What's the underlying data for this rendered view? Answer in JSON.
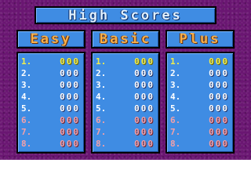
{
  "title": "High Scores",
  "tabs": {
    "easy": "Easy",
    "basic": "Basic",
    "plus": "Plus"
  },
  "lists": {
    "easy": [
      {
        "rank": "1.",
        "score": "000"
      },
      {
        "rank": "2.",
        "score": "000"
      },
      {
        "rank": "3.",
        "score": "000"
      },
      {
        "rank": "4.",
        "score": "000"
      },
      {
        "rank": "5.",
        "score": "000"
      },
      {
        "rank": "6.",
        "score": "000"
      },
      {
        "rank": "7.",
        "score": "000"
      },
      {
        "rank": "8.",
        "score": "000"
      }
    ],
    "basic": [
      {
        "rank": "1.",
        "score": "000"
      },
      {
        "rank": "2.",
        "score": "000"
      },
      {
        "rank": "3.",
        "score": "000"
      },
      {
        "rank": "4.",
        "score": "000"
      },
      {
        "rank": "5.",
        "score": "000"
      },
      {
        "rank": "6.",
        "score": "000"
      },
      {
        "rank": "7.",
        "score": "000"
      },
      {
        "rank": "8.",
        "score": "000"
      }
    ],
    "plus": [
      {
        "rank": "1.",
        "score": "000"
      },
      {
        "rank": "2.",
        "score": "000"
      },
      {
        "rank": "3.",
        "score": "000"
      },
      {
        "rank": "4.",
        "score": "000"
      },
      {
        "rank": "5.",
        "score": "000"
      },
      {
        "rank": "6.",
        "score": "000"
      },
      {
        "rank": "7.",
        "score": "000"
      },
      {
        "rank": "8.",
        "score": "000"
      }
    ]
  },
  "colors": {
    "background": "#6a1672",
    "panel": "#3f8ce3",
    "tab_text": "#f6b04c",
    "rank_1": "#f1ee4a",
    "rank_2_to_5": "#ffffff",
    "rank_6_to_8": "#f3a0a8"
  }
}
